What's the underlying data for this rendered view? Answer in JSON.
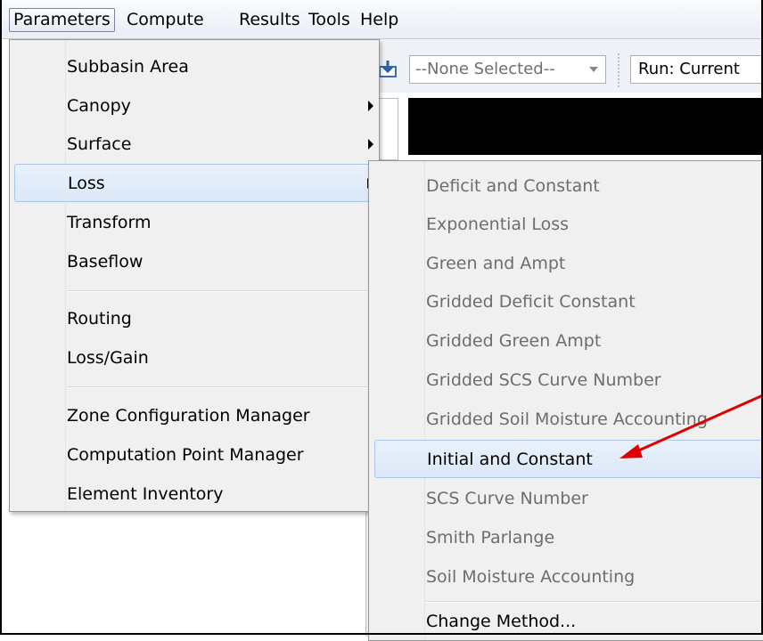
{
  "menubar": {
    "items": [
      "Parameters",
      "Compute",
      "Results",
      "Tools",
      "Help"
    ]
  },
  "toolbar": {
    "dropdown_value": "--None Selected--",
    "run_label": "Run: Current"
  },
  "parameters_menu": {
    "items": [
      {
        "label": "Subbasin Area"
      },
      {
        "label": "Canopy"
      },
      {
        "label": "Surface"
      },
      {
        "label": "Loss"
      },
      {
        "label": "Transform"
      },
      {
        "label": "Baseflow"
      },
      {
        "label": "Routing"
      },
      {
        "label": "Loss/Gain"
      },
      {
        "label": "Zone Configuration Manager"
      },
      {
        "label": "Computation Point Manager"
      },
      {
        "label": "Element Inventory"
      }
    ]
  },
  "loss_submenu": {
    "items": [
      {
        "label": "Deficit and Constant"
      },
      {
        "label": "Exponential Loss"
      },
      {
        "label": "Green and Ampt"
      },
      {
        "label": "Gridded Deficit Constant"
      },
      {
        "label": "Gridded Green Ampt"
      },
      {
        "label": "Gridded SCS Curve Number"
      },
      {
        "label": "Gridded Soil Moisture Accounting"
      },
      {
        "label": "Initial and Constant"
      },
      {
        "label": "SCS Curve Number"
      },
      {
        "label": "Smith Parlange"
      },
      {
        "label": "Soil Moisture Accounting"
      },
      {
        "label": "Change Method..."
      }
    ]
  },
  "colors": {
    "annotation_arrow": "#e00000",
    "highlight": "#dbe8f8"
  }
}
